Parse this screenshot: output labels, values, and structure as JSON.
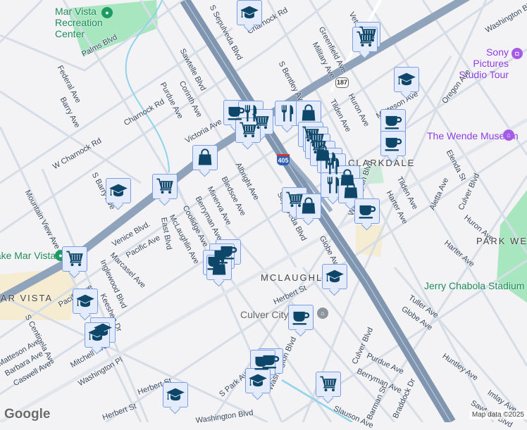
{
  "colors": {
    "highway": "#8a9fb8",
    "arterial": "#98aac0",
    "minor_road": "#d6dde6",
    "park": "#a8e6c0",
    "marker_fill": "#e4ecfb",
    "marker_border": "#7b9ee0",
    "icon": "#0d4668"
  },
  "shields": {
    "interstate": "405",
    "state_route": "187"
  },
  "places": {
    "rec_center": "Mar Vista Recreation Center",
    "sony": "Sony Pictures Studio Tour",
    "wende": "The Wende Museum",
    "stadium": "Jerry Chabola Stadium",
    "culver_city": "Culver City",
    "lake_mar_vista": "Lake Mar Vista"
  },
  "neighborhoods": [
    "CLARKDALE",
    "PARK WEST",
    "MCLAUGHLIN",
    "MAR VISTA"
  ],
  "streets": [
    "Palms Blvd",
    "Federal Ave",
    "Barry Ave",
    "Charnock Rd",
    "W Charnock Rd",
    "Purdue Ave",
    "Corinth Ave",
    "Sawtelle Blvd",
    "Victoria Ave",
    "S Sepulveda Blvd",
    "Charnock Rd",
    "S Bentley Ave",
    "Greenfield Ave",
    "Military Ave",
    "Huron Ave",
    "Tilden Ave",
    "Matteson Ave",
    "Oregon Ave",
    "Washington Blvd",
    "Elenda St",
    "Aletta Ave",
    "Culver Blvd",
    "Tilden Ave",
    "Harter Ave",
    "Harter Ave",
    "Huron Ave",
    "Albright Ave",
    "Bledsoe Ave",
    "Minerva Ave",
    "Berryman Ave",
    "Coolidge Ave",
    "McLaughlin Ave",
    "East Blvd",
    "Pacific Ave",
    "Marcasel Ave",
    "Inglewood Blvd",
    "Keeshen Dr",
    "Venice Blvd.",
    "Mountain View Ave",
    "S Barry Ave",
    "Pacific Ave",
    "S Centinela Ave",
    "Matteson Ave",
    "Barbara Ave",
    "Caswell Ave",
    "Mitchell Ave",
    "Washington Pl",
    "Herbert St",
    "Herbert St",
    "Washington Blvd",
    "S Park Ave",
    "Washington Blvd",
    "Herbert St",
    "Globe Ave",
    "Sepulveda Blvd",
    "Culver Blvd",
    "Purdue Ave",
    "Berryman Ave",
    "Barman St",
    "Braddock Dr",
    "Slauson Ave",
    "Tuller Ave",
    "Globe Ave",
    "Huntley Ave",
    "Imlay Ave",
    "Sawtelle Blvd",
    "Washington Blvd",
    "Veteran Ave"
  ],
  "markers": [
    "school",
    "cart",
    "cart",
    "school",
    "coffee",
    "coffee",
    "coffee",
    "restaurant",
    "cart",
    "cart",
    "bag",
    "restaurant",
    "bag",
    "cart",
    "cart",
    "cart",
    "bag",
    "restaurant",
    "restaurant",
    "bag",
    "restaurant",
    "bag",
    "cart",
    "bag",
    "coffee",
    "cart",
    "school",
    "cart",
    "coffee",
    "coffee",
    "coffee",
    "bag",
    "school",
    "school",
    "school",
    "school",
    "coffee",
    "coffee",
    "coffee",
    "school",
    "cart",
    "school"
  ],
  "branding": {
    "logo": "Google",
    "attribution": "Map data ©2025"
  }
}
